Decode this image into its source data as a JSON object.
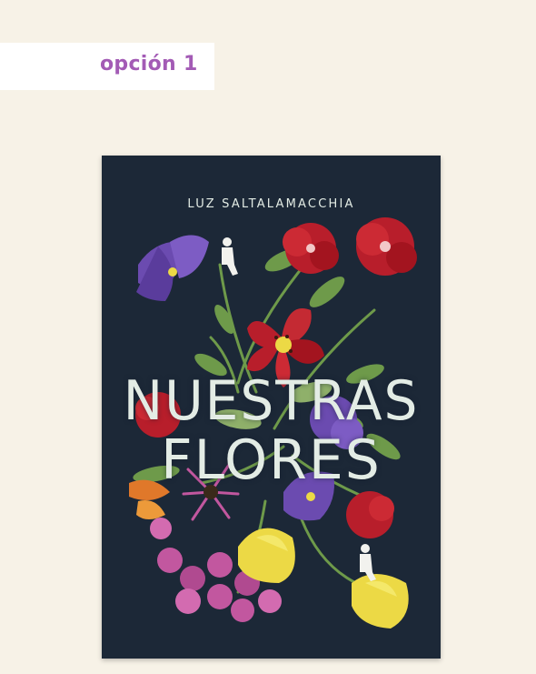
{
  "option_tag": {
    "label": "opción 1"
  },
  "cover": {
    "author": "LUZ SALTALAMACCHIA",
    "title_line1": "NUESTRAS",
    "title_line2": "FLORES"
  },
  "colors": {
    "background": "#f7f2e7",
    "tag_text": "#a35bb5",
    "cover_bg": "#1c2837",
    "cover_text": "#e3ece5",
    "red_flower": "#b81e2b",
    "purple_flower": "#6b4bb0",
    "yellow_flower": "#ecd945",
    "pink_flower": "#c2579f",
    "leaf": "#6e9a4a"
  }
}
